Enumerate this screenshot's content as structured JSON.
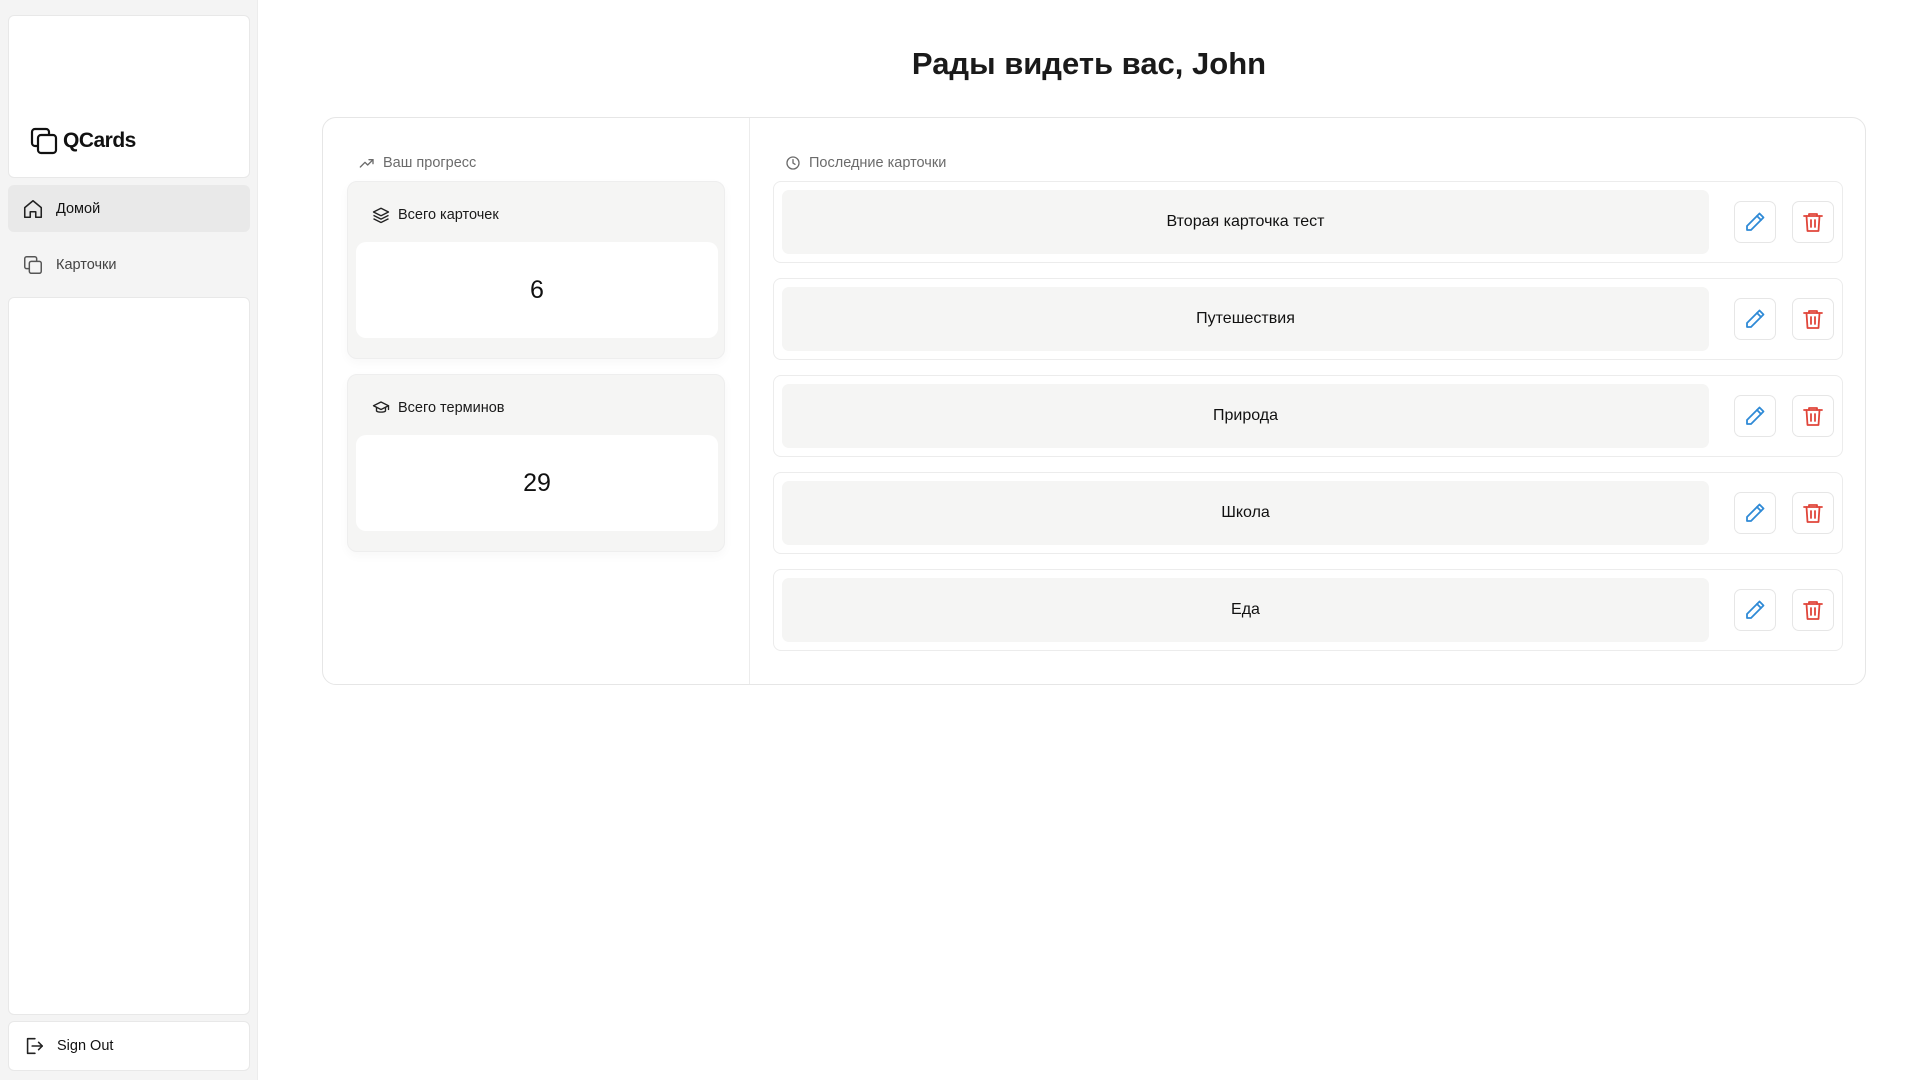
{
  "brand": {
    "name": "QCards"
  },
  "nav": {
    "items": [
      {
        "label": "Домой",
        "icon": "home-icon",
        "active": true
      },
      {
        "label": "Карточки",
        "icon": "cards-icon",
        "active": false
      }
    ],
    "sign_out": {
      "label": "Sign Out",
      "icon": "sign-out-icon"
    }
  },
  "page": {
    "title": "Рады видеть вас, John"
  },
  "progress": {
    "label": "Ваш прогресс",
    "icon": "trending-up-icon",
    "stats": [
      {
        "label": "Всего карточек",
        "value": "6",
        "icon": "layers-icon"
      },
      {
        "label": "Всего терминов",
        "value": "29",
        "icon": "graduation-cap-icon"
      }
    ]
  },
  "recent": {
    "label": "Последние карточки",
    "icon": "clock-icon",
    "cards": [
      {
        "name": "Вторая карточка тест"
      },
      {
        "name": "Путешествия"
      },
      {
        "name": "Природа"
      },
      {
        "name": "Школа"
      },
      {
        "name": "Еда"
      }
    ]
  },
  "colors": {
    "edit": "#2f8ad6",
    "delete": "#e0453a",
    "muted": "#6b6b6b"
  }
}
